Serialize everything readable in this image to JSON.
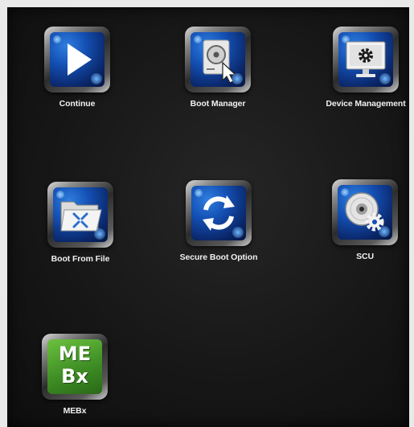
{
  "menu": {
    "items": [
      {
        "label": "Continue",
        "icon": "play-icon"
      },
      {
        "label": "Boot Manager",
        "icon": "boot-manager-icon"
      },
      {
        "label": "Device Management",
        "icon": "device-management-icon"
      },
      {
        "label": "Boot From File",
        "icon": "boot-from-file-icon"
      },
      {
        "label": "Secure Boot Option",
        "icon": "secure-boot-icon"
      },
      {
        "label": "SCU",
        "icon": "scu-icon"
      },
      {
        "label": "MEBx",
        "icon": "mebx-icon",
        "icon_text_line1": "ME",
        "icon_text_line2": "Bx"
      }
    ]
  },
  "colors": {
    "background": "#151515",
    "tile_blue": "#1450b4",
    "tile_green": "#3f8f25",
    "label": "#f0f0f0"
  }
}
